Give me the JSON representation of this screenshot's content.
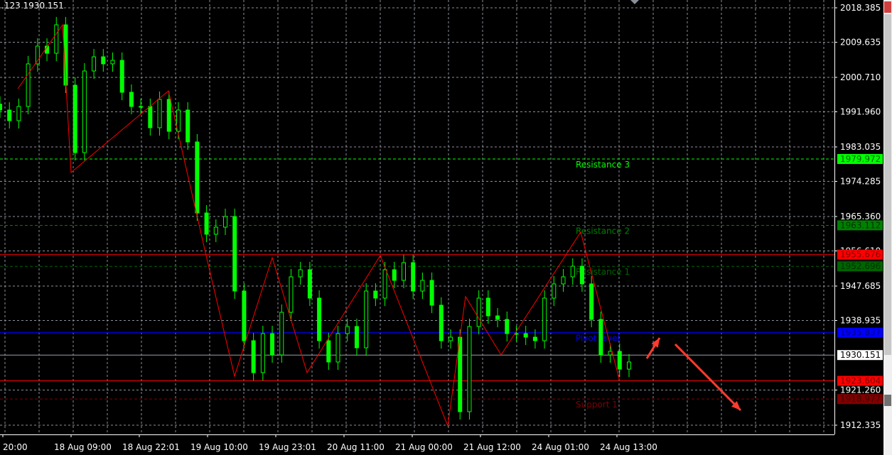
{
  "header": {
    "info_text": ".123 1930.151"
  },
  "colors": {
    "background": "#000000",
    "bull": "#00ff00",
    "grid": "#8a8f99",
    "zigzag": "#ff0000",
    "axis_text": "#ffffff",
    "arrow": "#ff3b30"
  },
  "chart_data": {
    "type": "candlestick",
    "ylim": [
      1908.0,
      2020.37
    ],
    "grid": true,
    "y_ticks": [
      "2018.385",
      "2009.635",
      "2000.710",
      "1991.960",
      "1983.035",
      "1974.285",
      "1965.360",
      "1956.610",
      "1947.685",
      "1938.935",
      "1921.260",
      "1912.335"
    ],
    "x_ticks": [
      "20:00",
      "18 Aug 09:00",
      "18 Aug 22:01",
      "19 Aug 10:00",
      "19 Aug 23:01",
      "20 Aug 11:00",
      "21 Aug 00:00",
      "21 Aug 12:00",
      "24 Aug 01:00",
      "24 Aug 13:00"
    ],
    "close": [
      1992.41,
      1989.71,
      1993.32,
      2004.14,
      2008.65,
      2006.84,
      2014.06,
      1998.73,
      1981.59,
      2002.33,
      2005.94,
      2004.14,
      2005.04,
      1996.92,
      1993.32,
      1993.32,
      1987.91,
      1995.12,
      1987.0,
      1992.41,
      1984.3,
      1966.26,
      1960.85,
      1962.65,
      1965.36,
      1946.42,
      1933.8,
      1925.68,
      1935.6,
      1930.19,
      1941.01,
      1950.03,
      1951.83,
      1944.62,
      1933.8,
      1928.39,
      1935.6,
      1937.41,
      1932.0,
      1946.42,
      1944.62,
      1951.83,
      1949.13,
      1953.64,
      1946.42,
      1949.13,
      1942.82,
      1933.8,
      1934.7,
      1915.76,
      1937.41,
      1944.62,
      1940.11,
      1939.21,
      1935.6,
      1935.6,
      1934.7,
      1933.8,
      1944.62,
      1948.23,
      1950.03,
      1952.73,
      1948.23,
      1939.21,
      1930.19,
      1931.09,
      1926.58,
      1928.39
    ],
    "zigzag": [
      1997.8,
      2014.06,
      1976.54,
      1997.28,
      1955.44,
      1924.78,
      1954.9,
      1925.68,
      1955.44,
      1912.15,
      1945.0,
      1930.19,
      1961.39,
      1923.52
    ],
    "levels": [
      {
        "name": "Resistance 3",
        "value": 1979.972,
        "label": "1979.972",
        "color": "#00ff00",
        "label_bg": "#00ff00",
        "label_fg": "#006400",
        "style": "dashed"
      },
      {
        "name": "Resistance 2",
        "value": 1963.112,
        "label": "1963.112",
        "color": "#008000",
        "label_bg": "#008000",
        "label_fg": "#003300",
        "style": "dashed"
      },
      {
        "name": "",
        "value": 1955.676,
        "label": "1955.676",
        "color": "#ff0000",
        "label_bg": "#ff0000",
        "label_fg": "#800000",
        "style": "solid"
      },
      {
        "name": "Resistance 1",
        "value": 1952.696,
        "label": "1952.696",
        "color": "#006400",
        "label_bg": "#006400",
        "label_fg": "#003300",
        "style": "dashed"
      },
      {
        "name": "Pivot level",
        "value": 1935.837,
        "label": "1935.837",
        "color": "#0000ff",
        "label_bg": "#0000ff",
        "label_fg": "#000080",
        "style": "solid"
      },
      {
        "name": "",
        "value": 1930.151,
        "label": "1930.151",
        "color": "#9aa0a8",
        "label_bg": "#ffffff",
        "label_fg": "#000000",
        "style": "solid"
      },
      {
        "name": "",
        "value": 1923.604,
        "label": "1923.604",
        "color": "#ff0000",
        "label_bg": "#ff0000",
        "label_fg": "#800000",
        "style": "solid"
      },
      {
        "name": "Support 1",
        "value": 1918.977,
        "label": "1918.977",
        "color": "#800000",
        "label_bg": "#800000",
        "label_fg": "#400000",
        "style": "dashed"
      }
    ]
  }
}
